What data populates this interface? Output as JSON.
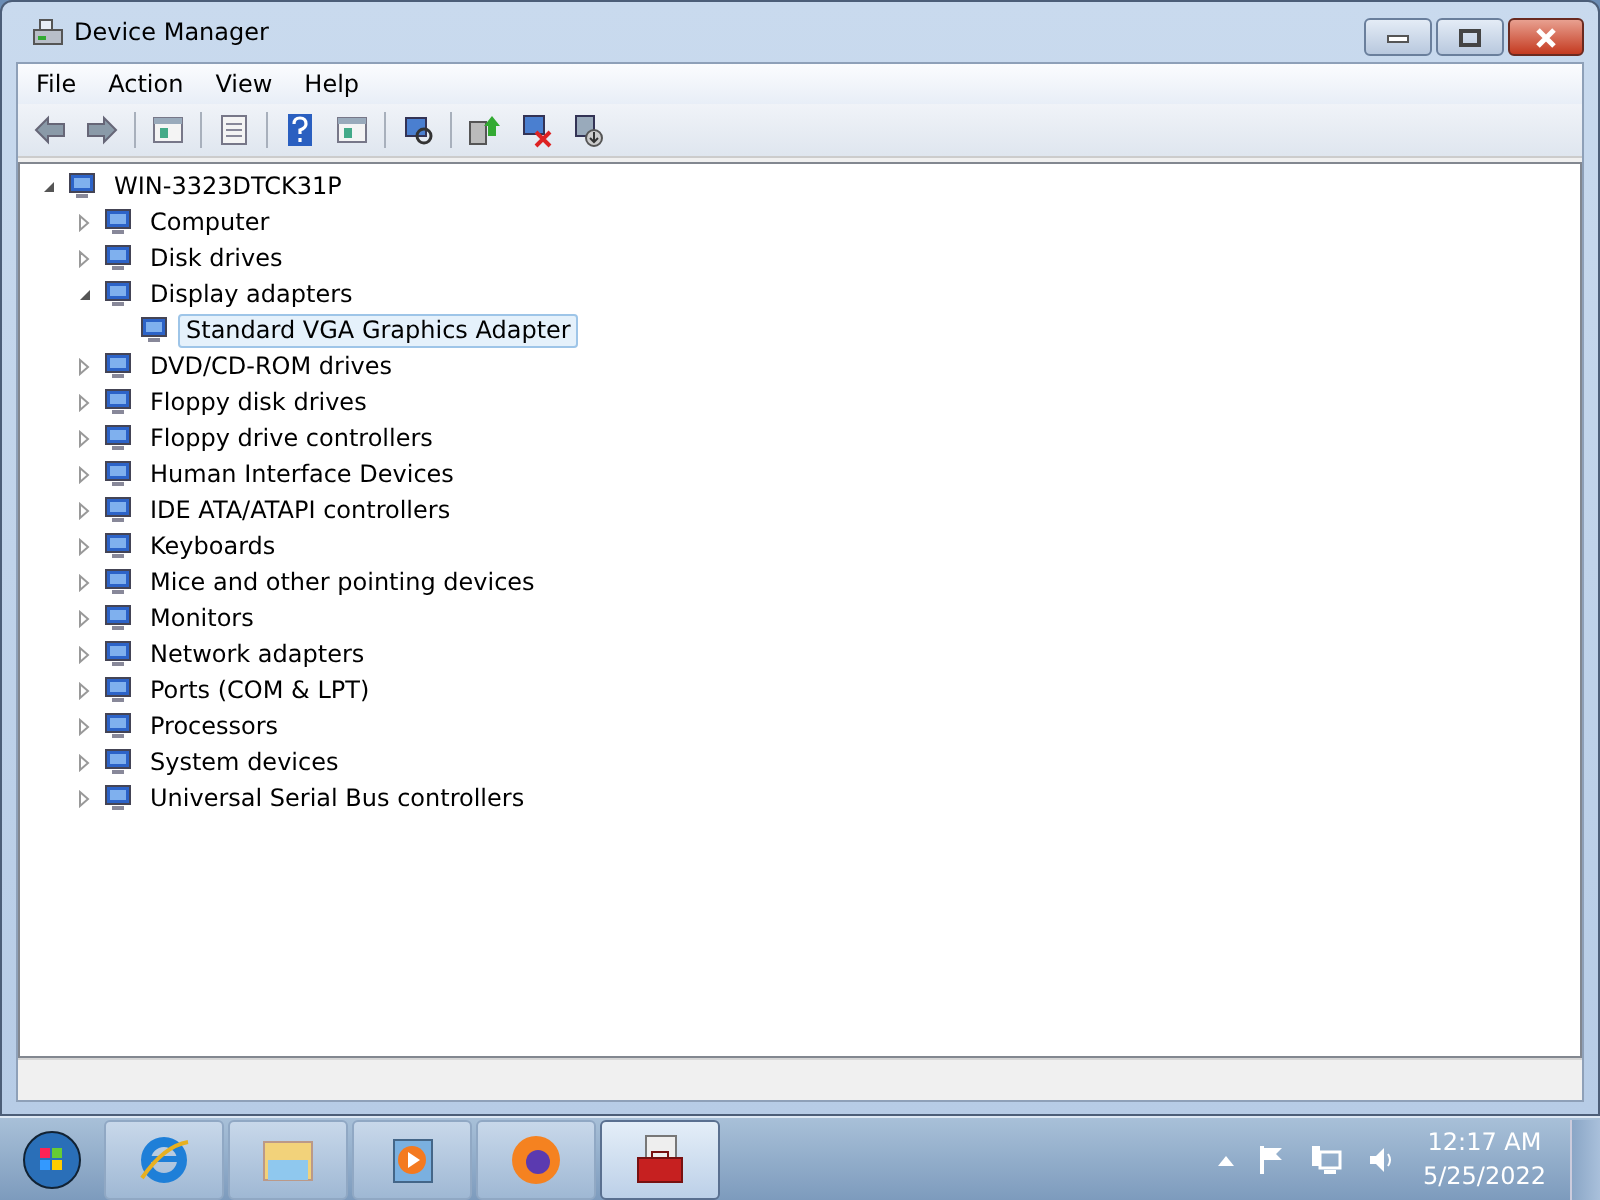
{
  "window": {
    "title": "Device Manager"
  },
  "menu": [
    "File",
    "Action",
    "View",
    "Help"
  ],
  "tree": [
    {
      "label": "WIN-3323DTCK31P",
      "expanded": true,
      "selected": false,
      "children": [
        {
          "label": "Computer",
          "expanded": false,
          "selected": false
        },
        {
          "label": "Disk drives",
          "expanded": false,
          "selected": false
        },
        {
          "label": "Display adapters",
          "expanded": true,
          "selected": false,
          "children": [
            {
              "label": "Standard VGA Graphics Adapter",
              "selected": true
            }
          ]
        },
        {
          "label": "DVD/CD-ROM drives",
          "expanded": false,
          "selected": false
        },
        {
          "label": "Floppy disk drives",
          "expanded": false,
          "selected": false
        },
        {
          "label": "Floppy drive controllers",
          "expanded": false,
          "selected": false
        },
        {
          "label": "Human Interface Devices",
          "expanded": false,
          "selected": false
        },
        {
          "label": "IDE ATA/ATAPI controllers",
          "expanded": false,
          "selected": false
        },
        {
          "label": "Keyboards",
          "expanded": false,
          "selected": false
        },
        {
          "label": "Mice and other pointing devices",
          "expanded": false,
          "selected": false
        },
        {
          "label": "Monitors",
          "expanded": false,
          "selected": false
        },
        {
          "label": "Network adapters",
          "expanded": false,
          "selected": false
        },
        {
          "label": "Ports (COM & LPT)",
          "expanded": false,
          "selected": false
        },
        {
          "label": "Processors",
          "expanded": false,
          "selected": false
        },
        {
          "label": "System devices",
          "expanded": false,
          "selected": false
        },
        {
          "label": "Universal Serial Bus controllers",
          "expanded": false,
          "selected": false
        }
      ]
    }
  ],
  "taskbar": {
    "buttons": [
      {
        "selected": false
      },
      {
        "selected": false
      },
      {
        "selected": false
      },
      {
        "selected": false
      },
      {
        "selected": true
      }
    ],
    "time": "12:17 AM",
    "date": "5/25/2022"
  }
}
